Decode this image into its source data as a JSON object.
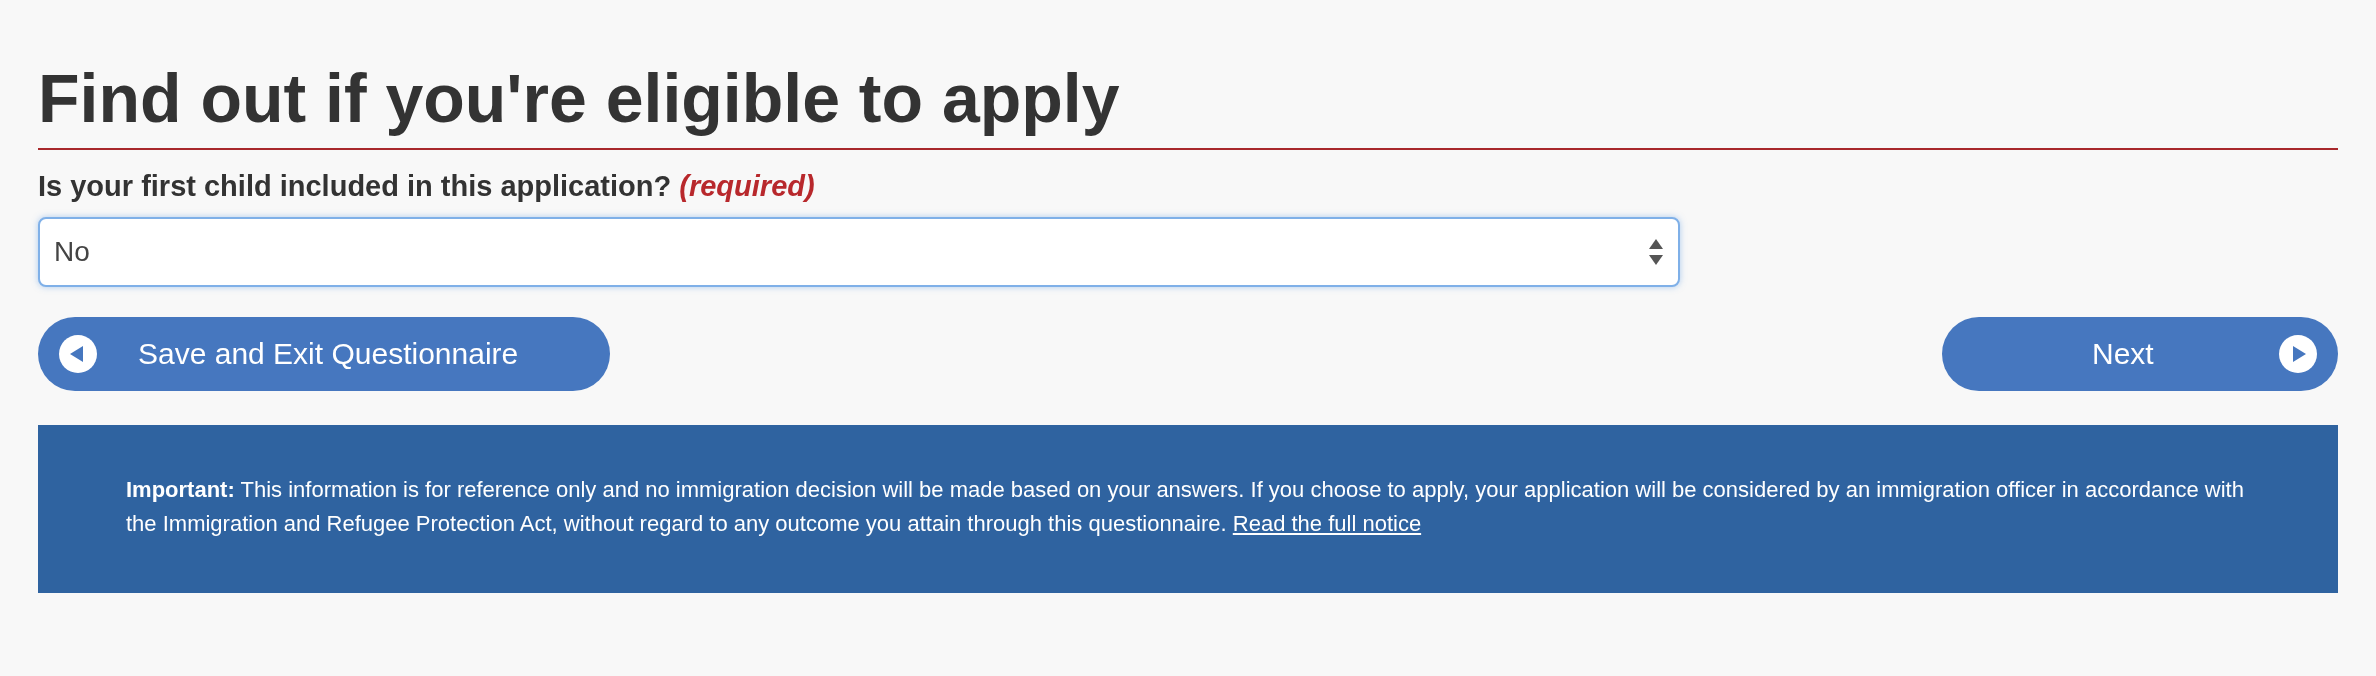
{
  "heading": "Find out if you're eligible to apply",
  "question": {
    "label": "Is your first child included in this application?",
    "required_note": "(required)",
    "value": "No"
  },
  "buttons": [
    {
      "kind": "back",
      "label": "Save and Exit Questionnaire"
    },
    {
      "kind": "next",
      "label": "Next"
    }
  ],
  "notice": {
    "text": "**Important:** This information is for reference only and no immigration decision will be made based on your answers. If you choose to apply, your application will be considered by an immigration officer in accordance with the Immigration and Refugee Protection Act, without regard to any outcome you attain through this questionnaire.",
    "link": "Read the full notice"
  }
}
